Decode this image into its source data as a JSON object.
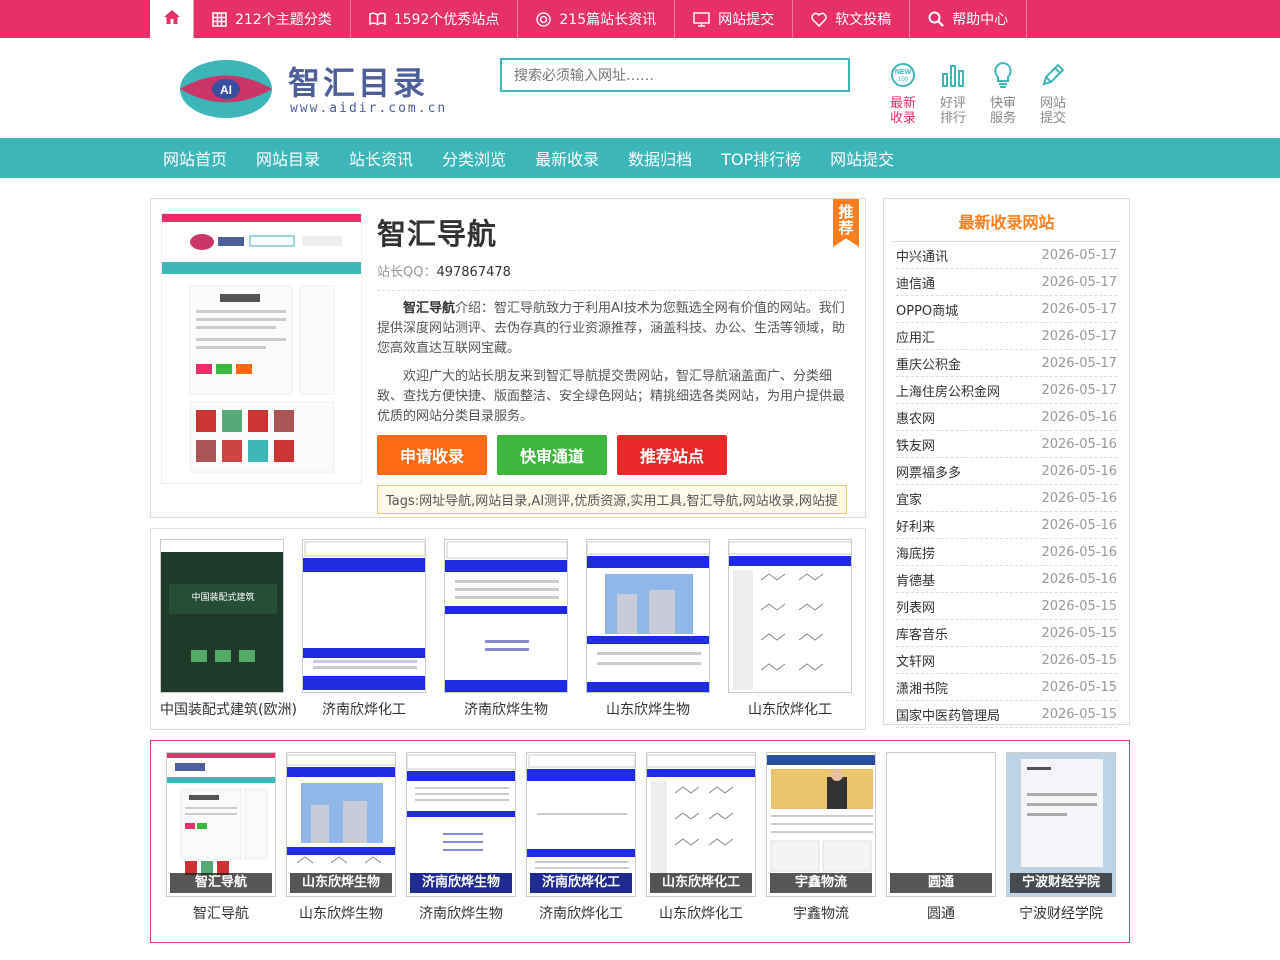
{
  "topbar": {
    "items": [
      {
        "icon": "grid-icon",
        "label": "212个主题分类"
      },
      {
        "icon": "book-icon",
        "label": "1592个优秀站点"
      },
      {
        "icon": "target-icon",
        "label": "215篇站长资讯"
      },
      {
        "icon": "monitor-icon",
        "label": "网站提交"
      },
      {
        "icon": "heart-icon",
        "label": "软文投稿"
      },
      {
        "icon": "search-icon",
        "label": "帮助中心"
      }
    ]
  },
  "logo": {
    "badge": "AI",
    "name": "智汇目录",
    "domain": "www.aidir.com.cn"
  },
  "search": {
    "placeholder": "搜索必须输入网址……"
  },
  "quick": [
    {
      "icon": "new-icon",
      "line1": "最新",
      "line2": "收录"
    },
    {
      "icon": "bar-chart-icon",
      "line1": "好评",
      "line2": "排行"
    },
    {
      "icon": "bulb-icon",
      "line1": "快审",
      "line2": "服务"
    },
    {
      "icon": "pen-icon",
      "line1": "网站",
      "line2": "提交"
    }
  ],
  "nav": [
    "网站首页",
    "网站目录",
    "站长资讯",
    "分类浏览",
    "最新收录",
    "数据归档",
    "TOP排行榜",
    "网站提交"
  ],
  "site": {
    "title": "智汇导航",
    "qq_label": "站长QQ：",
    "qq": "497867478",
    "desc_name": "智汇导航",
    "desc1": "介绍：智汇导航致力于利用AI技术为您甄选全网有价值的网站。我们提供深度网站测评、去伪存真的行业资源推荐，涵盖科技、办公、生活等领域，助您高效直达互联网宝藏。",
    "desc2": "欢迎广大的站长朋友来到智汇导航提交贵网站，智汇导航涵盖面广、分类细致、查找方便快捷、版面整洁、安全绿色网站；精挑细选各类网站，为用户提供最优质的网站分类目录服务。",
    "buttons": [
      {
        "label": "申请收录",
        "color": "#ff6a13"
      },
      {
        "label": "快审通道",
        "color": "#3db63d"
      },
      {
        "label": "推荐站点",
        "color": "#ea2a2a"
      }
    ],
    "tags": "Tags:网址导航,网站目录,AI测评,优质资源,实用工具,智汇导航,网站收录,网站提",
    "ribbon": "推荐"
  },
  "strip": [
    "中国装配式建筑(欧洲)",
    "济南欣烨化工",
    "济南欣烨生物",
    "山东欣烨生物",
    "山东欣烨化工"
  ],
  "sidebar": {
    "title": "最新收录网站",
    "items": [
      {
        "name": "中兴通讯",
        "date": "2026-05-17"
      },
      {
        "name": "迪信通",
        "date": "2026-05-17"
      },
      {
        "name": "OPPO商城",
        "date": "2026-05-17"
      },
      {
        "name": "应用汇",
        "date": "2026-05-17"
      },
      {
        "name": "重庆公积金",
        "date": "2026-05-17"
      },
      {
        "name": "上海住房公积金网",
        "date": "2026-05-17"
      },
      {
        "name": "惠农网",
        "date": "2026-05-16"
      },
      {
        "name": "铁友网",
        "date": "2026-05-16"
      },
      {
        "name": "网票福多多",
        "date": "2026-05-16"
      },
      {
        "name": "宜家",
        "date": "2026-05-16"
      },
      {
        "name": "好利来",
        "date": "2026-05-16"
      },
      {
        "name": "海底捞",
        "date": "2026-05-16"
      },
      {
        "name": "肯德基",
        "date": "2026-05-16"
      },
      {
        "name": "列表网",
        "date": "2026-05-15"
      },
      {
        "name": "库客音乐",
        "date": "2026-05-15"
      },
      {
        "name": "文轩网",
        "date": "2026-05-15"
      },
      {
        "name": "潇湘书院",
        "date": "2026-05-15"
      },
      {
        "name": "国家中医药管理局",
        "date": "2026-05-15"
      }
    ]
  },
  "bottom": [
    "智汇导航",
    "山东欣烨生物",
    "济南欣烨生物",
    "济南欣烨化工",
    "山东欣烨化工",
    "宇鑫物流",
    "圆通",
    "宁波财经学院"
  ],
  "colors": {
    "brand": "#e6306a",
    "accent": "#3cb6b9",
    "orange": "#ff7f1f"
  }
}
